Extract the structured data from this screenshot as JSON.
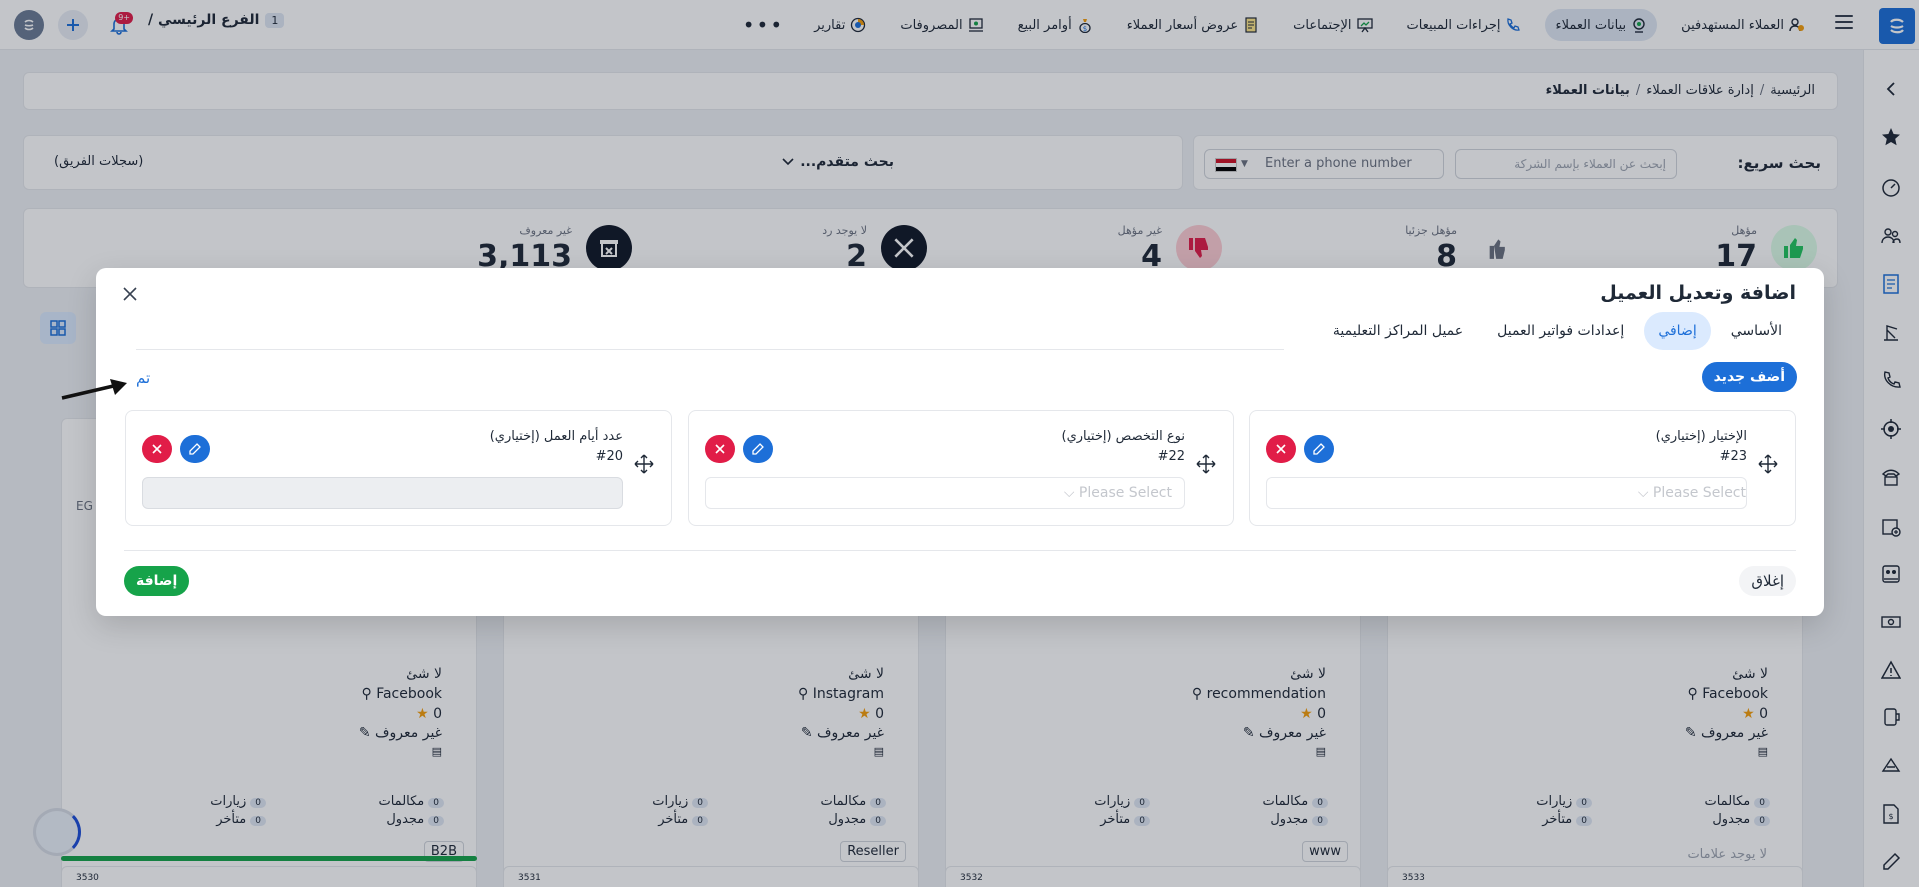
{
  "nav": {
    "items": [
      {
        "label": "العملاء المستهدفين",
        "icon": "users-target-icon",
        "active": false
      },
      {
        "label": "بيانات العملاء",
        "icon": "customer-data-icon",
        "active": true
      },
      {
        "label": "إجراءات المبيعات",
        "icon": "phone-icon",
        "active": false
      },
      {
        "label": "الإجتماعات",
        "icon": "meeting-board-icon",
        "active": false
      },
      {
        "label": "عروض أسعار العملاء",
        "icon": "quote-document-icon",
        "active": false
      },
      {
        "label": "أوامر البيع",
        "icon": "money-bag-icon",
        "active": false
      },
      {
        "label": "المصروفات",
        "icon": "expenses-icon",
        "active": false
      },
      {
        "label": "تقارير",
        "icon": "reports-icon",
        "active": false
      }
    ],
    "more": "•••",
    "branch_label": "الفرع الرئيسي /",
    "branch_number": "1",
    "notification_count": "+9"
  },
  "breadcrumb": {
    "home": "الرئيسية",
    "section": "إدارة علاقات العملاء",
    "current": "بيانات العملاء",
    "separator": "/"
  },
  "search": {
    "label": "بحث سريع:",
    "company_placeholder": "إبحث عن العملاء بإسم الشركة",
    "phone_placeholder": "Enter a phone number",
    "advanced": "بحث متقدم...",
    "team_records": "(سجلات الفريق)"
  },
  "stats": [
    {
      "label": "مؤهل",
      "value": "17",
      "color": "#22c55e"
    },
    {
      "label": "مؤهل جزئيا",
      "value": "8",
      "color": "#6b7280"
    },
    {
      "label": "غير مؤهل",
      "value": "4",
      "color": "#e11d48"
    },
    {
      "label": "لا يوجد رد",
      "value": "2",
      "color": "#111827"
    },
    {
      "label": "غير معروف",
      "value": "3,113",
      "color": "#111827"
    }
  ],
  "cards": [
    {
      "none": "لا شئ",
      "source": "Facebook",
      "rating": "0",
      "unknown": "غير معروف",
      "calls": "مكالمات",
      "visits": "زيارات",
      "scheduled": "مجدول",
      "late": "متأخر",
      "zero": "0",
      "tag": "لا يوجد علامات",
      "id": "3533"
    },
    {
      "none": "لا شئ",
      "source": "recommendation",
      "rating": "0",
      "unknown": "غير معروف",
      "calls": "مكالمات",
      "visits": "زيارات",
      "scheduled": "مجدول",
      "late": "متأخر",
      "zero": "0",
      "tag": "www",
      "id": "3532"
    },
    {
      "none": "لا شئ",
      "source": "Instagram",
      "rating": "0",
      "unknown": "غير معروف",
      "calls": "مكالمات",
      "visits": "زيارات",
      "scheduled": "مجدول",
      "late": "متأخر",
      "zero": "0",
      "tag": "Reseller",
      "id": "3531"
    },
    {
      "none": "لا شئ",
      "source": "Facebook",
      "rating": "0",
      "unknown": "غير معروف",
      "calls": "مكالمات",
      "visits": "زيارات",
      "scheduled": "مجدول",
      "late": "متأخر",
      "zero": "0",
      "tag": "B2B",
      "id": "3530"
    }
  ],
  "card_partial": {
    "prefix": "EG"
  },
  "modal": {
    "title": "اضافة وتعديل العميل",
    "tabs": [
      {
        "label": "الأساسي",
        "active": false
      },
      {
        "label": "إضافي",
        "active": true
      },
      {
        "label": "إعدادات فواتير العميل",
        "active": false
      },
      {
        "label": "عميل المراكز التعليمية",
        "active": false
      }
    ],
    "add_new": "أضف جديد",
    "done": "تم",
    "fields": [
      {
        "label": "الإختيار (إختياري)",
        "id": "#23",
        "placeholder": "Please Select ⌵",
        "type": "select"
      },
      {
        "label": "نوع التخصص (إختياري)",
        "id": "#22",
        "placeholder": "Please Select ⌵",
        "type": "select"
      },
      {
        "label": "عدد أيام العمل (إختياري)",
        "id": "#20",
        "placeholder": "",
        "type": "text"
      }
    ],
    "close_button": "إغلاق",
    "submit_button": "إضافة"
  },
  "colors": {
    "primary": "#1d6fd8",
    "danger": "#e11d48",
    "success": "#16a34a"
  }
}
